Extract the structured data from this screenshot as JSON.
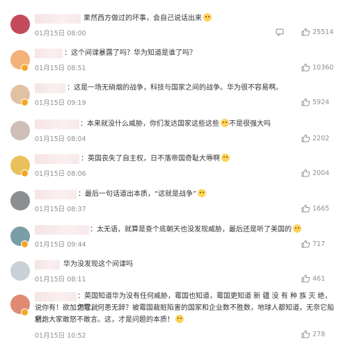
{
  "comments": [
    {
      "text": "果然西方做过的坏事，会自己说话出来",
      "time": "01月15日 08:00",
      "likes": "25514",
      "avatar_color": "#c44b5c"
    },
    {
      "text": "：这个间谍暴露了吗？华为知道是谁了吗？",
      "time": "01月15日 08:51",
      "likes": "10360",
      "avatar_color": "#f2b27a"
    },
    {
      "text": "：这是一场无硝烟的战争，科技与国家之间的战争。华为很不容易啊。",
      "time": "01月15日 09:19",
      "likes": "5924",
      "avatar_color": "#e2c0a2"
    },
    {
      "text": "：本来就没什么威胁，你们发达国家这些这些",
      "text2": "不是很强大吗",
      "time": "01月15日 08:04",
      "likes": "2202",
      "avatar_color": "#cdbfb7"
    },
    {
      "text": "：英国丧失了自主权，日不落帝国奇耻大辱啊",
      "time": "01月15日 08:06",
      "likes": "2004",
      "avatar_color": "#e8c15a"
    },
    {
      "text": "：最后一句话道出本质，“这就是战争”",
      "time": "01月15日 08:37",
      "likes": "1665",
      "avatar_color": "#8b8f92"
    },
    {
      "text": "：太无语，就算是查个底朝天也没发现威胁，最后还是听了美国的",
      "time": "01月15日 09:44",
      "likes": "717",
      "avatar_color": "#7a9ea6"
    },
    {
      "text": "华为没发现这个间谍吗",
      "time": "01月15日 08:11",
      "likes": "461",
      "avatar_color": "#c9d0d6"
    },
    {
      "text_lines": [
        "：英国知道华为没有任何威胁，霉国也知道，霉国更知道 新 疆 没 有 种 族 灭 绝，但它就",
        "说你有！欲加之罪，何患无辞？被霉国裁赃陷害的国家和企业数不胜数，地球人都知道，无奈它船坚炮",
        "利，大家敢怒不敢言。这，才是问题的本质！"
      ],
      "time": "01月15日 10:52",
      "likes": "278",
      "avatar_color": "#e08a73"
    }
  ],
  "icons": {
    "reply": "comment-icon",
    "like": "thumb-up-icon"
  }
}
